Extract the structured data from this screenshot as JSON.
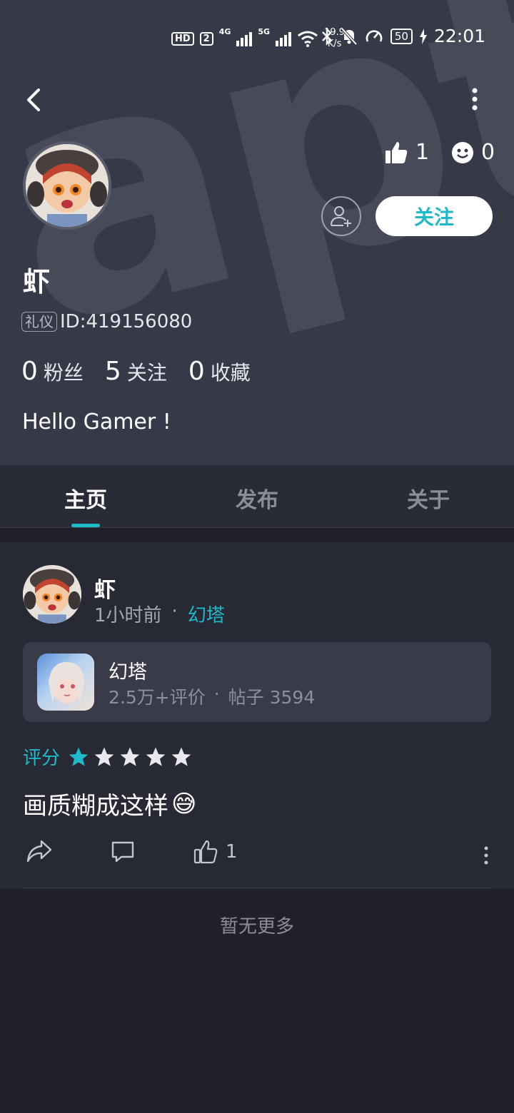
{
  "status_bar": {
    "hd": "HD",
    "sim": "2",
    "net1": "4G",
    "net2": "5G",
    "speed_value": "19.9",
    "speed_unit": "K/s",
    "battery": "50",
    "time": "22:01"
  },
  "profile": {
    "like_count": "1",
    "face_count": "0",
    "follow_label": "关注",
    "name": "虾",
    "tag": "礼仪",
    "id_text": "ID:419156080",
    "fans_count": "0",
    "fans_label": "粉丝",
    "following_count": "5",
    "following_label": "关注",
    "favorites_count": "0",
    "favorites_label": "收藏",
    "bio": "Hello Gamer !",
    "watermark": "apta"
  },
  "tabs": [
    {
      "label": "主页",
      "active": true
    },
    {
      "label": "发布",
      "active": false
    },
    {
      "label": "关于",
      "active": false
    }
  ],
  "post": {
    "author": "虾",
    "time": "1小时前",
    "separator": "·",
    "game": "幻塔",
    "card": {
      "title": "幻塔",
      "reviews": "2.5万+评价",
      "separator": "·",
      "posts": "帖子 3594"
    },
    "rating_label": "评分",
    "rating_value": 1,
    "rating_max": 5,
    "text": "画质糊成这样",
    "emoji": "😅",
    "like_count": "1"
  },
  "footer_text": "暂无更多",
  "colors": {
    "accent": "#1fb9c9",
    "header_bg": "#363a48",
    "page_bg": "#1f2029",
    "card_bg": "#272934"
  }
}
